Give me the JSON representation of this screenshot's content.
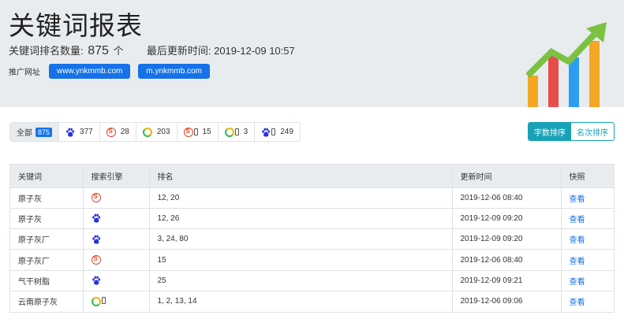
{
  "header": {
    "title": "关键词报表",
    "keyword_count_label": "关键词排名数量:",
    "keyword_count": "875",
    "keyword_count_unit": "个",
    "last_update_label": "最后更新时间:",
    "last_update": "2019-12-09 10:57",
    "promo_label": "推广网址",
    "promo_sites": [
      "www.ynkmmb.com",
      "m.ynkmmb.com"
    ]
  },
  "filters": [
    {
      "icon": "",
      "label": "全部",
      "count": "875",
      "active": true
    },
    {
      "icon": "baidu-paw-icon",
      "count": "377"
    },
    {
      "icon": "sogou-icon",
      "count": "28"
    },
    {
      "icon": "360-search-icon",
      "count": "203"
    },
    {
      "icon": "sogou-mobile-icon",
      "count": "15"
    },
    {
      "icon": "360-mobile-icon",
      "count": "3"
    },
    {
      "icon": "baidu-mobile-icon",
      "count": "249"
    }
  ],
  "sort": {
    "by_words": "字数排序",
    "by_rank": "名次排序"
  },
  "table": {
    "headers": {
      "keyword": "关键词",
      "engine": "搜索引擎",
      "rank": "排名",
      "updated": "更新时间",
      "snapshot": "快照"
    },
    "rows": [
      {
        "keyword": "原子灰",
        "engine": "sogou-icon",
        "rank": "12, 20",
        "updated": "2019-12-06 08:40",
        "snapshot": "查看"
      },
      {
        "keyword": "原子灰",
        "engine": "baidu-paw-icon",
        "rank": "12, 26",
        "updated": "2019-12-09 09:20",
        "snapshot": "查看"
      },
      {
        "keyword": "原子灰厂",
        "engine": "baidu-paw-icon",
        "rank": "3, 24, 80",
        "updated": "2019-12-09 09:20",
        "snapshot": "查看"
      },
      {
        "keyword": "原子灰厂",
        "engine": "sogou-icon",
        "rank": "15",
        "updated": "2019-12-06 08:40",
        "snapshot": "查看"
      },
      {
        "keyword": "气干树脂",
        "engine": "baidu-paw-icon",
        "rank": "25",
        "updated": "2019-12-09 09:21",
        "snapshot": "查看"
      },
      {
        "keyword": "云南原子灰",
        "engine": "360-mobile-icon",
        "rank": "1, 2, 13, 14",
        "updated": "2019-12-06 09:06",
        "snapshot": "查看"
      }
    ]
  },
  "colors": {
    "primary": "#1572e8",
    "info": "#17a2b8",
    "header_bg": "#e9ecef"
  }
}
